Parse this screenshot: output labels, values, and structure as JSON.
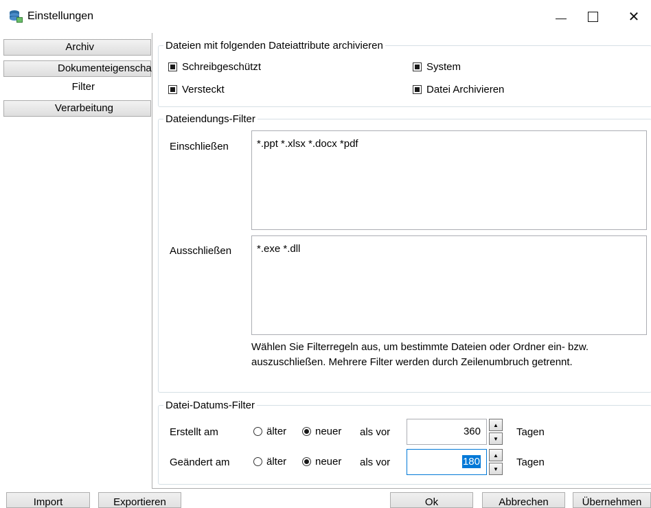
{
  "window": {
    "title": "Einstellungen",
    "controls": {
      "minimize": "—",
      "close": "✕"
    },
    "icon": "stacked-disks-icon"
  },
  "tabs": [
    {
      "label": "Archiv",
      "active": false
    },
    {
      "label": "Dokumenteigenschaften",
      "active": false
    },
    {
      "label": "Filter",
      "active": true
    },
    {
      "label": "Verarbeitung",
      "active": false
    }
  ],
  "attributes": {
    "legend": "Dateien mit folgenden Dateiattribute archivieren",
    "items": [
      {
        "label": "Schreibgeschützt",
        "checked": true
      },
      {
        "label": "System",
        "checked": true
      },
      {
        "label": "Versteckt",
        "checked": true
      },
      {
        "label": "Datei Archivieren",
        "checked": true
      }
    ]
  },
  "extension_filter": {
    "legend": "Dateiendungs-Filter",
    "include_label": "Einschließen",
    "include_value": "*.ppt *.xlsx *.docx *pdf",
    "exclude_label": "Ausschließen",
    "exclude_value": "*.exe *.dll",
    "help_text": "Wählen Sie Filterregeln aus, um bestimmte Dateien oder Ordner ein- bzw. auszuschließen. Mehrere Filter werden durch Zeilenumbruch getrennt."
  },
  "date_filter": {
    "legend": "Datei-Datums-Filter",
    "rows": [
      {
        "label": "Erstellt am",
        "older": "älter",
        "newer": "neuer",
        "selected": "newer",
        "prefix": "als vor",
        "value": "360",
        "unit": "Tagen"
      },
      {
        "label": "Geändert am",
        "older": "älter",
        "newer": "neuer",
        "selected": "newer",
        "prefix": "als vor",
        "value": "180",
        "unit": "Tagen"
      }
    ]
  },
  "buttons": {
    "import": "Import",
    "export": "Exportieren",
    "ok": "Ok",
    "cancel": "Abbrechen",
    "apply": "Übernehmen"
  },
  "colors": {
    "accent": "#0078d7",
    "border": "#acacac",
    "groupbox": "#d5dfe5"
  }
}
